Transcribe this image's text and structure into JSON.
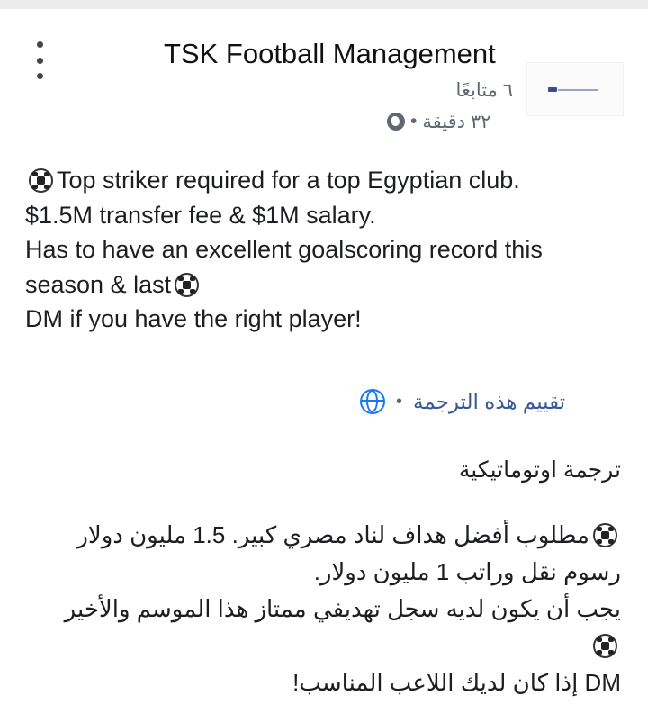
{
  "header": {
    "page_name": "TSK Football Management",
    "followers": "٦ متابعًا",
    "time": "٣٢ دقيقة",
    "separator": "•",
    "audience_icon": "globe-icon",
    "more_icon": "more-vertical-icon"
  },
  "post": {
    "lines": [
      "Top striker required for a top Egyptian club.",
      "$1.5M transfer fee & $1M salary.",
      "Has to have an excellent goalscoring record this",
      "season & last",
      "DM if you have the right player!"
    ],
    "emoji_icon": "soccer-ball-icon"
  },
  "translation": {
    "rate_label": "تقييم هذه الترجمة",
    "separator": "•",
    "auto_title": "ترجمة اوتوماتيكية",
    "lines": [
      "مطلوب أفضل هداف لناد مصري كبير. 1.5 مليون دولار",
      "رسوم نقل وراتب 1 مليون دولار.",
      "يجب أن يكون لديه سجل تهديفي ممتاز هذا الموسم والأخير",
      "!إذا كان لديك اللاعب المناسب DM"
    ]
  },
  "colors": {
    "link": "#385898",
    "secondary_text": "#606770",
    "globe_accent": "#1877f2"
  }
}
